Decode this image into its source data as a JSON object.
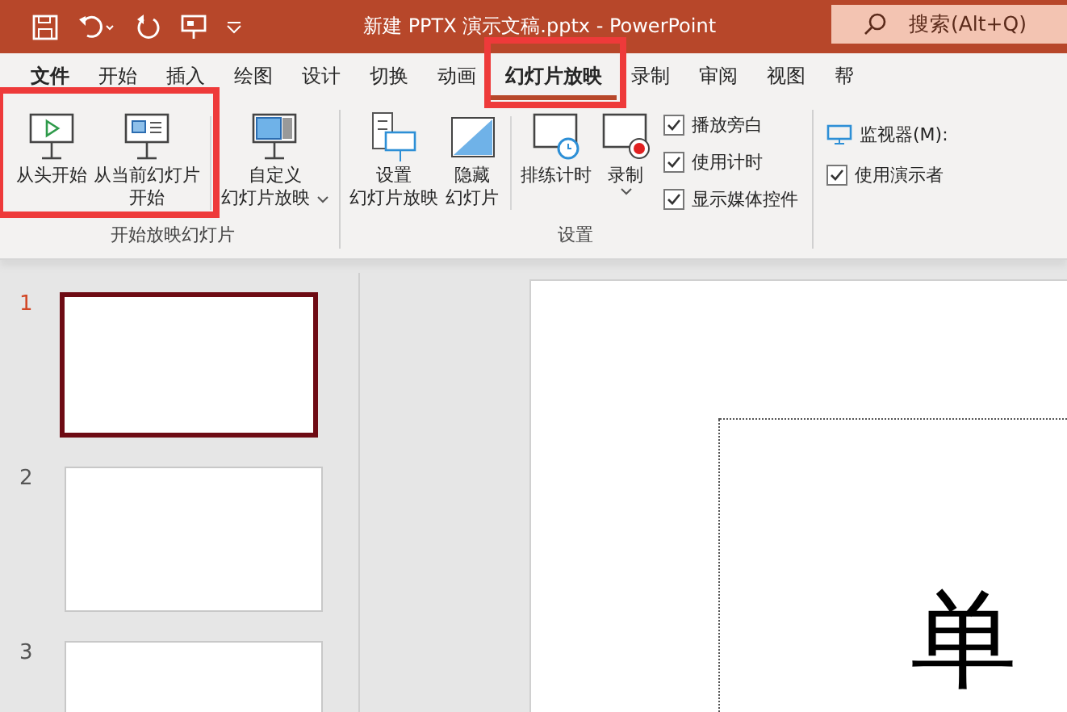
{
  "title_bar": {
    "title": "新建 PPTX 演示文稿.pptx  -  PowerPoint",
    "search": {
      "placeholder": "搜索(Alt+Q)"
    }
  },
  "tabs": [
    {
      "label": "文件",
      "kind": "file",
      "selected": false,
      "highlighted": false
    },
    {
      "label": "开始",
      "kind": "tab",
      "selected": false,
      "highlighted": false
    },
    {
      "label": "插入",
      "kind": "tab",
      "selected": false,
      "highlighted": false
    },
    {
      "label": "绘图",
      "kind": "tab",
      "selected": false,
      "highlighted": false
    },
    {
      "label": "设计",
      "kind": "tab",
      "selected": false,
      "highlighted": false
    },
    {
      "label": "切换",
      "kind": "tab",
      "selected": false,
      "highlighted": false
    },
    {
      "label": "动画",
      "kind": "tab",
      "selected": false,
      "highlighted": false
    },
    {
      "label": "幻灯片放映",
      "kind": "tab",
      "selected": true,
      "highlighted": true
    },
    {
      "label": "录制",
      "kind": "tab",
      "selected": false,
      "highlighted": false
    },
    {
      "label": "审阅",
      "kind": "tab",
      "selected": false,
      "highlighted": false
    },
    {
      "label": "视图",
      "kind": "tab",
      "selected": false,
      "highlighted": false
    },
    {
      "label": "帮",
      "kind": "tab",
      "selected": false,
      "highlighted": false
    }
  ],
  "ribbon_groups": [
    {
      "label": "开始放映幻灯片",
      "items": [
        {
          "kind": "button",
          "lines": [
            "从头开始"
          ],
          "highlighted": true
        },
        {
          "kind": "button",
          "lines": [
            "从当前幻灯片",
            "开始"
          ],
          "highlighted": true
        },
        {
          "kind": "separator"
        },
        {
          "kind": "button",
          "lines": [
            "自定义",
            "幻灯片放映"
          ],
          "dropdown": true
        }
      ]
    },
    {
      "label": "设置",
      "items": [
        {
          "kind": "button",
          "lines": [
            "设置",
            "幻灯片放映"
          ]
        },
        {
          "kind": "button",
          "lines": [
            "隐藏",
            "幻灯片"
          ]
        },
        {
          "kind": "separator"
        },
        {
          "kind": "button",
          "lines": [
            "排练计时"
          ]
        },
        {
          "kind": "button",
          "lines": [
            "录制"
          ],
          "dropdown": true
        },
        {
          "kind": "checks",
          "checks": [
            {
              "label": "播放旁白",
              "checked": true
            },
            {
              "label": "使用计时",
              "checked": true
            },
            {
              "label": "显示媒体控件",
              "checked": true
            }
          ]
        }
      ]
    },
    {
      "items": [
        {
          "kind": "monitor",
          "label": "监视器(M):"
        },
        {
          "kind": "checks",
          "checks": [
            {
              "label": "使用演示者",
              "checked": true
            }
          ]
        }
      ]
    }
  ],
  "slides": [
    {
      "number": "1",
      "selected": true
    },
    {
      "number": "2",
      "selected": false
    },
    {
      "number": "3",
      "selected": false
    }
  ],
  "slide": {
    "title": "单"
  }
}
